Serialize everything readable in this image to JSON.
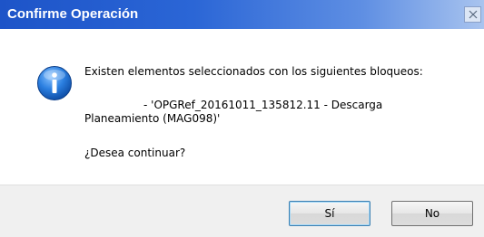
{
  "dialog": {
    "title": "Confirme Operación",
    "close_symbol": "X",
    "icon": "information-icon",
    "message_line1": "Existen elementos seleccionados con los siguientes bloqueos:",
    "message_line2": "- 'OPGRef_20161011_135812.11 - Descarga",
    "message_line3": "Planeamiento (MAG098)'",
    "question": "¿Desea continuar?",
    "buttons": {
      "yes_label": "Sí",
      "no_label": "No"
    }
  },
  "colors": {
    "titlebar": "#2b66d6",
    "footer": "#f0f0f0",
    "info_icon": "#1f6fd0"
  }
}
